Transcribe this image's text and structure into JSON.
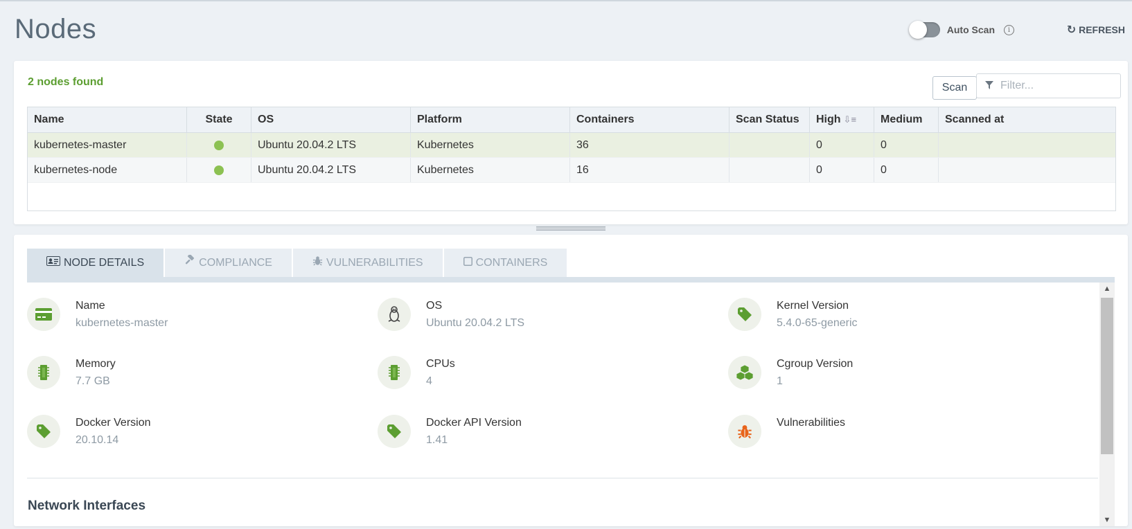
{
  "page": {
    "title": "Nodes"
  },
  "header": {
    "auto_scan_label": "Auto Scan",
    "auto_scan_on": false,
    "refresh_label": "REFRESH"
  },
  "nodes": {
    "found_text": "2 nodes found",
    "scan_label": "Scan",
    "filter_placeholder": "Filter...",
    "columns": [
      "Name",
      "State",
      "OS",
      "Platform",
      "Containers",
      "Scan Status",
      "High",
      "Medium",
      "Scanned at"
    ],
    "rows": [
      {
        "name": "kubernetes-master",
        "state": "running",
        "os": "Ubuntu 20.04.2 LTS",
        "platform": "Kubernetes",
        "containers": "36",
        "scan_status": "",
        "high": "0",
        "medium": "0",
        "scanned_at": ""
      },
      {
        "name": "kubernetes-node",
        "state": "running",
        "os": "Ubuntu 20.04.2 LTS",
        "platform": "Kubernetes",
        "containers": "16",
        "scan_status": "",
        "high": "0",
        "medium": "0",
        "scanned_at": ""
      }
    ]
  },
  "tabs": [
    {
      "label": "NODE DETAILS",
      "icon": "id-card-icon",
      "active": true
    },
    {
      "label": "COMPLIANCE",
      "icon": "gavel-icon",
      "active": false
    },
    {
      "label": "VULNERABILITIES",
      "icon": "bug-icon",
      "active": false
    },
    {
      "label": "CONTAINERS",
      "icon": "square-icon",
      "active": false
    }
  ],
  "details": {
    "items": [
      {
        "label": "Name",
        "value": "kubernetes-master",
        "icon": "card-icon"
      },
      {
        "label": "OS",
        "value": "Ubuntu 20.04.2 LTS",
        "icon": "linux-icon"
      },
      {
        "label": "Kernel Version",
        "value": "5.4.0-65-generic",
        "icon": "tag-icon"
      },
      {
        "label": "Memory",
        "value": "7.7 GB",
        "icon": "memory-icon"
      },
      {
        "label": "CPUs",
        "value": "4",
        "icon": "cpu-icon"
      },
      {
        "label": "Cgroup Version",
        "value": "1",
        "icon": "cubes-icon"
      },
      {
        "label": "Docker Version",
        "value": "20.10.14",
        "icon": "tag-icon"
      },
      {
        "label": "Docker API Version",
        "value": "1.41",
        "icon": "tag-icon"
      },
      {
        "label": "Vulnerabilities",
        "value": "",
        "icon": "bug-icon"
      }
    ],
    "network_title": "Network Interfaces"
  },
  "colors": {
    "accent_green": "#5c9e31",
    "state_dot": "#8cc152",
    "icon_green": "#5c9e31",
    "bug_orange": "#e8641b"
  }
}
